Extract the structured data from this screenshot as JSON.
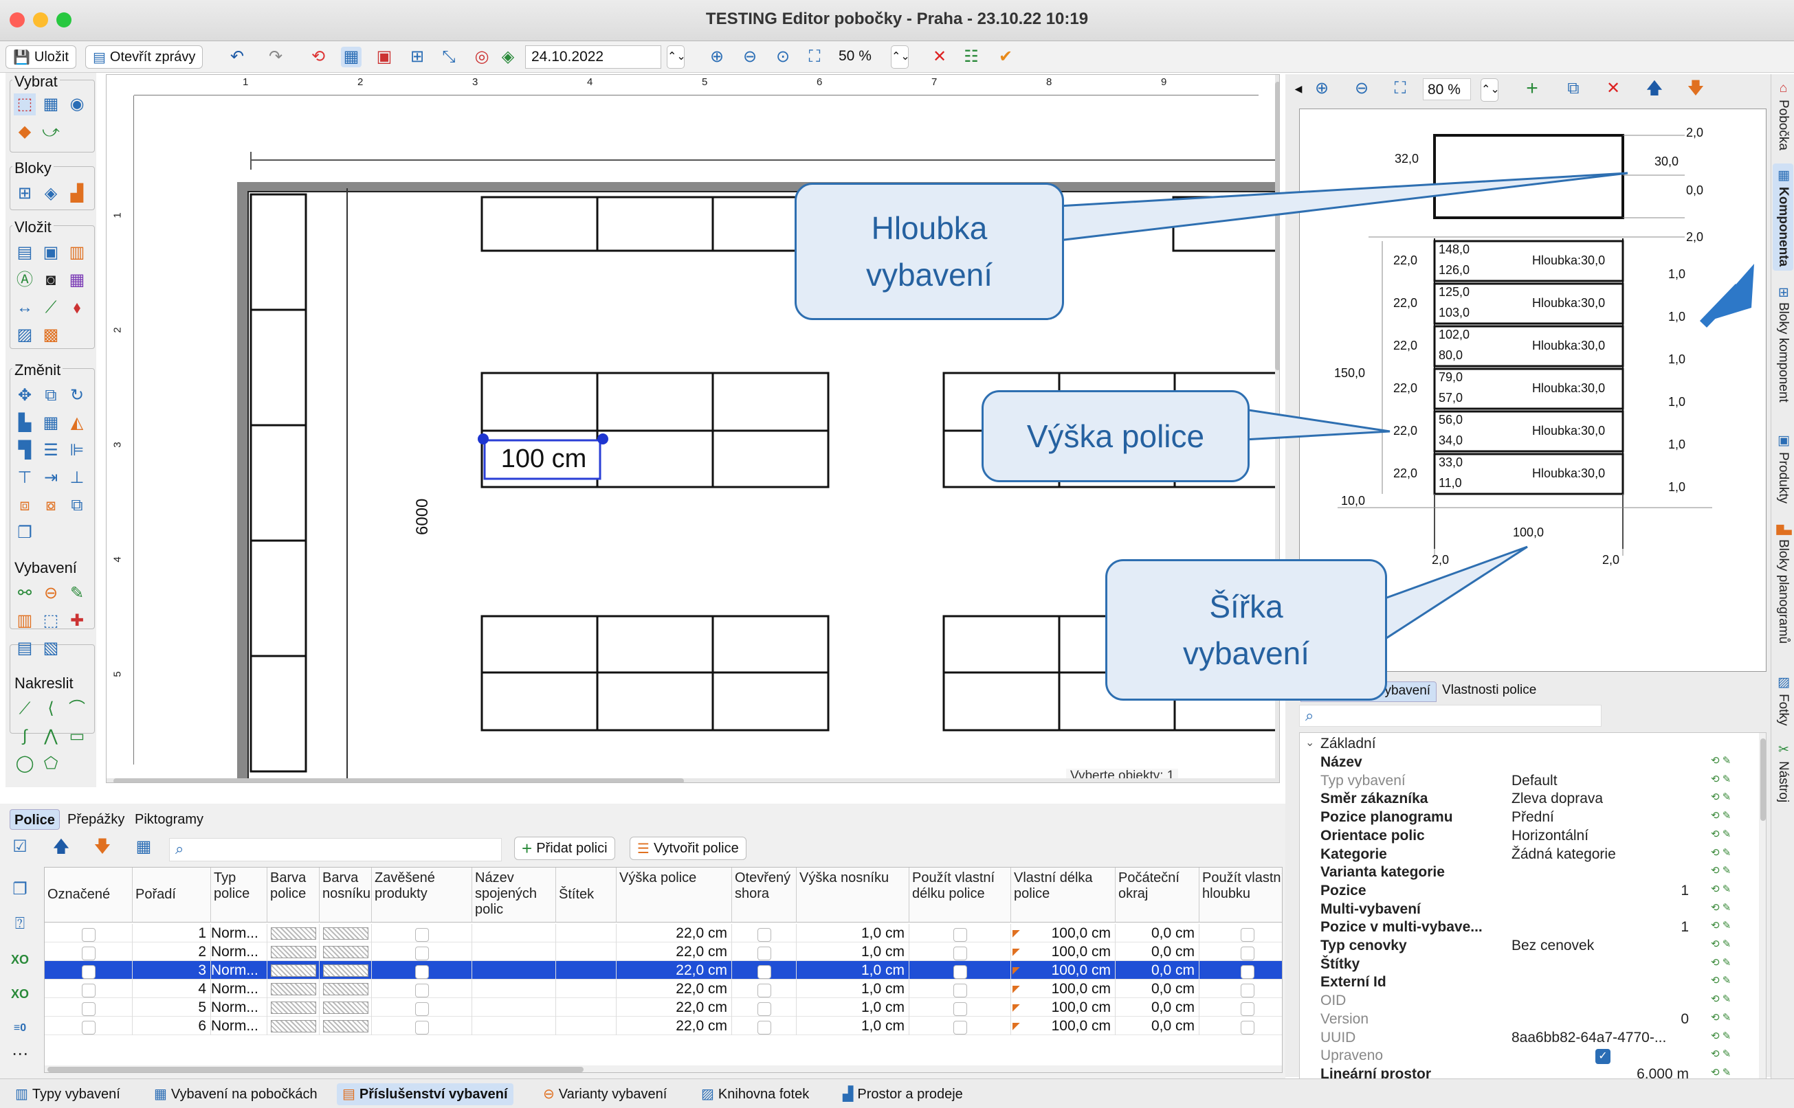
{
  "window": {
    "title": "TESTING Editor pobočky - Praha - 23.10.22 10:19"
  },
  "toolbar": {
    "save_label": "Uložit",
    "open_reports_label": "Otevřít zprávy",
    "date_value": "24.10.2022",
    "zoom_value": "50 %"
  },
  "palette": {
    "groups": [
      {
        "label": "Vybrat"
      },
      {
        "label": "Bloky"
      },
      {
        "label": "Vložit"
      },
      {
        "label": "Změnit"
      },
      {
        "label": "Vybavení"
      },
      {
        "label": "Nakreslit"
      }
    ]
  },
  "canvas": {
    "ruler_numbers": [
      "1",
      "2",
      "3",
      "4",
      "5",
      "6",
      "7",
      "8",
      "9"
    ],
    "ruler_v_numbers": [
      "1",
      "2",
      "3",
      "4",
      "5"
    ],
    "dimension_label": "100 cm",
    "vertical_dim_label": "6000",
    "status_fragment": "Vyberte objekty:  1"
  },
  "callouts": {
    "depth": "Hloubka vybavení",
    "shelf_height": "Výška police",
    "width": "Šířka vybavení"
  },
  "preview": {
    "zoom_value": "80 %",
    "top_dims": {
      "left": "32,0",
      "right_top": "2,0",
      "right_mid": "30,0",
      "right_low": "0,0",
      "right_shelf_top": "2,0"
    },
    "total_height": "150,0",
    "left_bottom": "10,0",
    "width_label": "100,0",
    "bottom_left": "2,0",
    "bottom_right": "2,0",
    "shelves": [
      {
        "left": "22,0",
        "top": "148,0",
        "bottom": "126,0",
        "depth": "Hloubka:30,0",
        "right": "1,0"
      },
      {
        "left": "22,0",
        "top": "125,0",
        "bottom": "103,0",
        "depth": "Hloubka:30,0",
        "right": "1,0"
      },
      {
        "left": "22,0",
        "top": "102,0",
        "bottom": "80,0",
        "depth": "Hloubka:30,0",
        "right": "1,0"
      },
      {
        "left": "22,0",
        "top": "79,0",
        "bottom": "57,0",
        "depth": "Hloubka:30,0",
        "right": "1,0"
      },
      {
        "left": "22,0",
        "top": "56,0",
        "bottom": "34,0",
        "depth": "Hloubka:30,0",
        "right": "1,0"
      },
      {
        "left": "22,0",
        "top": "33,0",
        "bottom": "11,0",
        "depth": "Hloubka:30,0",
        "right": "1,0"
      }
    ]
  },
  "props_tabs": {
    "tab1": "vybavení",
    "tab2": "Vlastnosti police"
  },
  "props": {
    "section": "Základní",
    "rows": [
      {
        "k": "Název",
        "v": ""
      },
      {
        "k": "Typ vybavení",
        "v": "Default"
      },
      {
        "k": "Směr zákazníka",
        "v": "Zleva doprava"
      },
      {
        "k": "Pozice planogramu",
        "v": "Přední"
      },
      {
        "k": "Orientace polic",
        "v": "Horizontální"
      },
      {
        "k": "Kategorie",
        "v": "Žádná kategorie"
      },
      {
        "k": "Varianta kategorie",
        "v": ""
      },
      {
        "k": "Pozice",
        "v": "1"
      },
      {
        "k": "Multi-vybavení",
        "v": ""
      },
      {
        "k": "Pozice v multi-vybave...",
        "v": "1"
      },
      {
        "k": "Typ cenovky",
        "v": "Bez cenovek"
      },
      {
        "k": "Štítky",
        "v": ""
      },
      {
        "k": "Externí Id",
        "v": ""
      },
      {
        "k": "OID",
        "v": ""
      },
      {
        "k": "Version",
        "v": "0"
      },
      {
        "k": "UUID",
        "v": "8aa6bb82-64a7-4770-..."
      },
      {
        "k": "Upraveno",
        "v": ""
      },
      {
        "k": "Lineární prostor",
        "v": "6.000 m"
      }
    ]
  },
  "side_tabs": [
    "Pobočka",
    "Komponenta",
    "Bloky komponent",
    "Produkty",
    "Bloky planogramů",
    "Fotky",
    "Nástroj"
  ],
  "bottom_tabs": [
    "Police",
    "Přepážky",
    "Piktogramy"
  ],
  "bottom_buttons": {
    "add": "Přidat polici",
    "create": "Vytvořit police"
  },
  "grid": {
    "headers": [
      "Označené",
      "Pořadí",
      "Typ police",
      "Barva police",
      "Barva nosníku",
      "Zavěšené produkty",
      "Název spojených polic",
      "Štítek",
      "Výška police",
      "Otevřený shora",
      "Výška nosníku",
      "Použít vlastní délku police",
      "Vlastní délka police",
      "Počáteční okraj",
      "Použít vlastní hloubku",
      "Hl"
    ],
    "rows": [
      {
        "order": "1",
        "type": "Norm...",
        "height": "22,0 cm",
        "beam": "1,0 cm",
        "length": "100,0 cm",
        "margin": "0,0 cm"
      },
      {
        "order": "2",
        "type": "Norm...",
        "height": "22,0 cm",
        "beam": "1,0 cm",
        "length": "100,0 cm",
        "margin": "0,0 cm"
      },
      {
        "order": "3",
        "type": "Norm...",
        "height": "22,0 cm",
        "beam": "1,0 cm",
        "length": "100,0 cm",
        "margin": "0,0 cm"
      },
      {
        "order": "4",
        "type": "Norm...",
        "height": "22,0 cm",
        "beam": "1,0 cm",
        "length": "100,0 cm",
        "margin": "0,0 cm"
      },
      {
        "order": "5",
        "type": "Norm...",
        "height": "22,0 cm",
        "beam": "1,0 cm",
        "length": "100,0 cm",
        "margin": "0,0 cm"
      },
      {
        "order": "6",
        "type": "Norm...",
        "height": "22,0 cm",
        "beam": "1,0 cm",
        "length": "100,0 cm",
        "margin": "0,0 cm"
      }
    ]
  },
  "status_tabs": [
    "Typy vybavení",
    "Vybavení na pobočkách",
    "Příslušenství vybavení",
    "Varianty vybavení",
    "Knihovna fotek",
    "Prostor a prodeje"
  ]
}
